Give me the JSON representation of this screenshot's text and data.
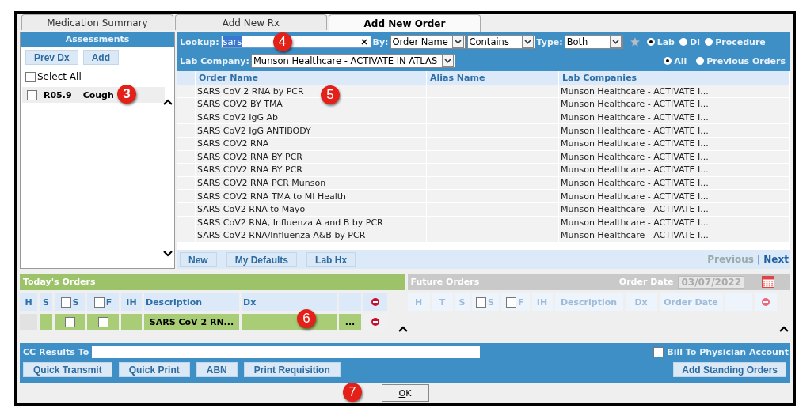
{
  "tabs": [
    {
      "label": "Medication Summary",
      "selected": false
    },
    {
      "label": "Add New Rx",
      "selected": false
    },
    {
      "label": "Add New Order",
      "selected": true
    }
  ],
  "assessments": {
    "title": "Assessments",
    "buttons": [
      "Prev Dx",
      "Add"
    ],
    "select_all": {
      "label": "Select All",
      "checked": false
    },
    "items": [
      {
        "code": "R05.9",
        "name": "Cough",
        "checked": false,
        "callout": "3"
      }
    ]
  },
  "lookup": {
    "label": "Lookup:",
    "value": "sars",
    "callout": "4",
    "by_label": "By:",
    "by_value": "Order Name",
    "match_value": "Contains",
    "type_label": "Type:",
    "type_value": "Both",
    "categories": [
      {
        "label": "Lab",
        "selected": true
      },
      {
        "label": "DI",
        "selected": false
      },
      {
        "label": "Procedure",
        "selected": false
      }
    ],
    "lab_company_label": "Lab Company:",
    "lab_company_value": "Munson Healthcare - ACTIVATE IN ATLAS",
    "scopes": [
      {
        "label": "All",
        "selected": true
      },
      {
        "label": "Previous Orders",
        "selected": false
      }
    ]
  },
  "orders_table": {
    "columns": [
      "Order Name",
      "Alias Name",
      "Lab Companies"
    ],
    "callout": "5",
    "rows": [
      {
        "order_name": "SARS CoV 2 RNA by PCR",
        "lab_company": "Munson Healthcare - ACTIVATE I..."
      },
      {
        "order_name": "SARS COV2 BY TMA",
        "lab_company": "Munson Healthcare - ACTIVATE I..."
      },
      {
        "order_name": "SARS CoV2 IgG Ab",
        "lab_company": "Munson Healthcare - ACTIVATE I..."
      },
      {
        "order_name": "SARS CoV2 IgG ANTIBODY",
        "lab_company": "Munson Healthcare - ACTIVATE I..."
      },
      {
        "order_name": "SARS COV2 RNA",
        "lab_company": "Munson Healthcare - ACTIVATE I..."
      },
      {
        "order_name": "SARS COV2 RNA BY PCR",
        "lab_company": "Munson Healthcare - ACTIVATE I..."
      },
      {
        "order_name": "SARS COV2 RNA BY PCR",
        "lab_company": "Munson Healthcare - ACTIVATE I..."
      },
      {
        "order_name": "SARS COV2 RNA PCR Munson",
        "lab_company": "Munson Healthcare - ACTIVATE I..."
      },
      {
        "order_name": "SARS COV2 RNA TMA to MI Health",
        "lab_company": "Munson Healthcare - ACTIVATE I..."
      },
      {
        "order_name": "SARS CoV2 RNA to Mayo",
        "lab_company": "Munson Healthcare - ACTIVATE I..."
      },
      {
        "order_name": "SARS CoV2 RNA, Influenza A and B by PCR",
        "lab_company": "Munson Healthcare - ACTIVATE I..."
      },
      {
        "order_name": "SARS CoV2 RNA/Influenza A&B by PCR",
        "lab_company": "Munson Healthcare - ACTIVATE I..."
      }
    ],
    "buttons": [
      "New",
      "My Defaults",
      "Lab Hx"
    ],
    "pager": [
      {
        "label": "Previous",
        "disabled": true
      },
      {
        "label": "|",
        "disabled": false
      },
      {
        "label": "Next",
        "disabled": false
      }
    ]
  },
  "todays_orders": {
    "title": "Today's Orders",
    "callout": "6",
    "columns": [
      {
        "kind": "text",
        "label": "H"
      },
      {
        "kind": "text",
        "label": "S"
      },
      {
        "kind": "checkbox",
        "label": "S",
        "checked": false
      },
      {
        "kind": "checkbox",
        "label": "F",
        "checked": false
      },
      {
        "kind": "text",
        "label": "IH"
      },
      {
        "kind": "text",
        "label": "Description"
      },
      {
        "kind": "text",
        "label": "Dx"
      },
      {
        "kind": "blank"
      },
      {
        "kind": "remove"
      }
    ],
    "rows": [
      {
        "description": "SARS CoV 2 RN...",
        "s_checked": false,
        "f_checked": false,
        "more": "..."
      }
    ]
  },
  "future_orders": {
    "title": "Future Orders",
    "date_label": "Order Date",
    "date_value": "03/07/2022",
    "columns": [
      {
        "kind": "text",
        "label": "H"
      },
      {
        "kind": "text",
        "label": "T"
      },
      {
        "kind": "text",
        "label": "S"
      },
      {
        "kind": "checkbox",
        "label": "S",
        "checked": false
      },
      {
        "kind": "checkbox",
        "label": "F",
        "checked": false
      },
      {
        "kind": "text",
        "label": "IH"
      },
      {
        "kind": "text",
        "label": "Description"
      },
      {
        "kind": "text",
        "label": "Dx"
      },
      {
        "kind": "text",
        "label": "Order Date"
      },
      {
        "kind": "blank"
      },
      {
        "kind": "remove"
      }
    ]
  },
  "footer": {
    "cc_label": "CC Results To",
    "bill": {
      "label": "Bill To Physician Account",
      "checked": false
    },
    "buttons": [
      "Quick Transmit",
      "Quick Print",
      "ABN",
      "Print Requisition"
    ],
    "standing_button": "Add Standing Orders"
  },
  "ok": {
    "label": "OK",
    "callout": "7"
  }
}
